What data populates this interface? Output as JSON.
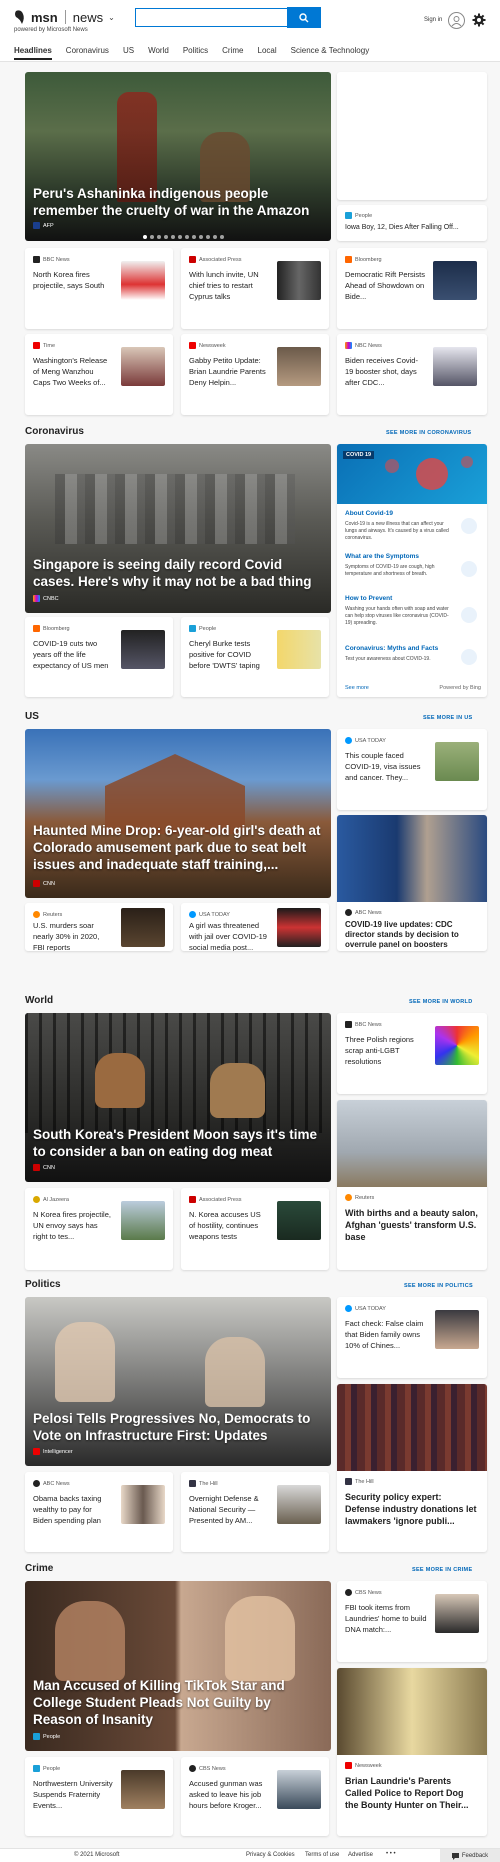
{
  "header": {
    "brand": "msn",
    "section": "news",
    "powered_by": "powered by Microsoft News",
    "search_placeholder": "",
    "signin": "Sign in"
  },
  "nav": [
    "Headlines",
    "Coronavirus",
    "US",
    "World",
    "Politics",
    "Crime",
    "Local",
    "Science & Technology"
  ],
  "top": {
    "hero": {
      "title": "Peru's Ashaninka indigenous people remember the cruelty of war in the Amazon",
      "source": "AFP"
    },
    "side": {
      "source": "People",
      "title": "Iowa Boy, 12, Dies After Falling Off..."
    },
    "cards": [
      {
        "source": "BBC News",
        "title": "North Korea fires projectile, says South"
      },
      {
        "source": "Associated Press",
        "title": "With lunch invite, UN chief tries to restart Cyprus talks"
      },
      {
        "source": "Bloomberg",
        "title": "Democratic Rift Persists Ahead of Showdown on Bide..."
      },
      {
        "source": "Time",
        "title": "Washington's Release of Meng Wanzhou Caps Two Weeks of..."
      },
      {
        "source": "Newsweek",
        "title": "Gabby Petito Update: Brian Laundrie Parents Deny Helpin..."
      },
      {
        "source": "NBC News",
        "title": "Biden receives Covid-19 booster shot, days after CDC..."
      }
    ]
  },
  "sections": {
    "coronavirus": {
      "title": "Coronavirus",
      "see_more": "SEE MORE IN CORONAVIRUS",
      "hero": {
        "title": "Singapore is seeing daily record Covid cases. Here's why it may not be a bad thing",
        "source": "CNBC"
      },
      "cards": [
        {
          "source": "Bloomberg",
          "title": "COVID-19 cuts two years off the life expectancy of US men"
        },
        {
          "source": "People",
          "title": "Cheryl Burke tests positive for COVID before 'DWTS' taping"
        }
      ],
      "panel": {
        "badge": "COVID 19",
        "items": [
          {
            "h": "About Covid-19",
            "d": "Covid-19 is a new illness that can affect your lungs and airways. It's caused by a virus called coronavirus."
          },
          {
            "h": "What are the Symptoms",
            "d": "Symptoms of COVID-19 are cough, high temperature and shortness of breath."
          },
          {
            "h": "How to Prevent",
            "d": "Washing your hands often with soap and water can help stop viruses like coronavirus (COVID-19) spreading."
          },
          {
            "h": "Coronavirus: Myths and Facts",
            "d": "Test your awareness about COVID-19."
          }
        ],
        "see_more": "See more",
        "powered": "Powered by Bing"
      }
    },
    "us": {
      "title": "US",
      "see_more": "SEE MORE IN US",
      "hero": {
        "title": "Haunted Mine Drop: 6-year-old girl's death at Colorado amusement park due to seat belt issues and inadequate staff training,...",
        "source": "CNN"
      },
      "side_small": {
        "source": "USA TODAY",
        "title": "This couple faced COVID-19, visa issues and cancer. They..."
      },
      "side_big": {
        "source": "ABC News",
        "title": "COVID-19 live updates: CDC director stands by decision to overrule panel on boosters"
      },
      "cards": [
        {
          "source": "Reuters",
          "title": "U.S. murders soar nearly 30% in 2020, FBI reports"
        },
        {
          "source": "USA TODAY",
          "title": "A girl was threatened with jail over COVID-19 social media post..."
        }
      ]
    },
    "world": {
      "title": "World",
      "see_more": "SEE MORE IN WORLD",
      "hero": {
        "title": "South Korea's President Moon says it's time to consider a ban on eating dog meat",
        "source": "CNN"
      },
      "side_small": {
        "source": "BBC News",
        "title": "Three Polish regions scrap anti-LGBT resolutions"
      },
      "side_big": {
        "source": "Reuters",
        "title": "With births and a beauty salon, Afghan 'guests' transform U.S. base"
      },
      "cards": [
        {
          "source": "Al Jazeera",
          "title": "N Korea fires projectile, UN envoy says has right to tes..."
        },
        {
          "source": "Associated Press",
          "title": "N. Korea accuses US of hostility, continues weapons tests"
        }
      ]
    },
    "politics": {
      "title": "Politics",
      "see_more": "SEE MORE IN POLITICS",
      "hero": {
        "title": "Pelosi Tells Progressives No, Democrats to Vote on Infrastructure First: Updates",
        "source": "Intelligencer"
      },
      "side_small": {
        "source": "USA TODAY",
        "title": "Fact check: False claim that Biden family owns 10% of Chines..."
      },
      "side_big": {
        "source": "The Hill",
        "title": "Security policy expert: Defense industry donations let lawmakers 'ignore publi..."
      },
      "cards": [
        {
          "source": "ABC News",
          "title": "Obama backs taxing wealthy to pay for Biden spending plan"
        },
        {
          "source": "The Hill",
          "title": "Overnight Defense & National Security — Presented by AM..."
        }
      ]
    },
    "crime": {
      "title": "Crime",
      "see_more": "SEE MORE IN CRIME",
      "hero": {
        "title": "Man Accused of Killing TikTok Star and College Student Pleads Not Guilty by Reason of Insanity",
        "source": "People"
      },
      "side_small": {
        "source": "CBS News",
        "title": "FBI took items from Laundries' home to build DNA match:..."
      },
      "side_big": {
        "source": "Newsweek",
        "title": "Brian Laundrie's Parents Called Police to Report Dog the Bounty Hunter on Their..."
      },
      "cards": [
        {
          "source": "People",
          "title": "Northwestern University Suspends Fraternity Events..."
        },
        {
          "source": "CBS News",
          "title": "Accused gunman was asked to leave his job hours before Kroger..."
        }
      ]
    }
  },
  "footer": {
    "copyright": "© 2021 Microsoft",
    "links": [
      "Privacy & Cookies",
      "Terms of use",
      "Advertise"
    ],
    "more": "• • •",
    "feedback": "Feedback"
  }
}
